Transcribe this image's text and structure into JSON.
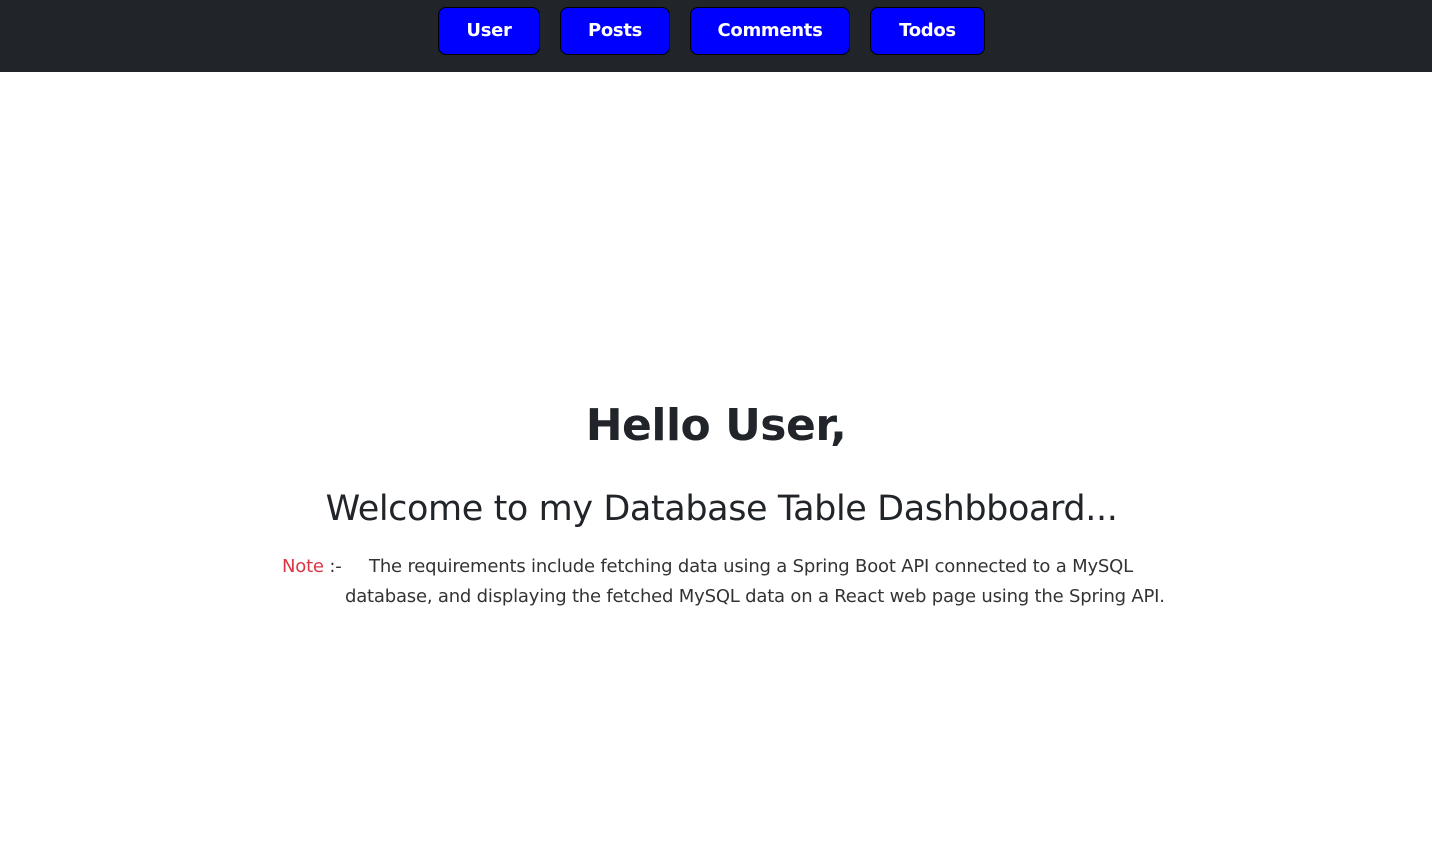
{
  "navbar": {
    "buttons": [
      {
        "label": "User"
      },
      {
        "label": "Posts"
      },
      {
        "label": "Comments"
      },
      {
        "label": "Todos"
      }
    ]
  },
  "main": {
    "title": "Hello User,",
    "subtitle": "Welcome to my Database Table Dashbboard...",
    "note": {
      "label": "Note",
      "separator": ":-",
      "line1": "The requirements include fetching data using a Spring Boot API connected to a MySQL",
      "line2": "database, and displaying the fetched MySQL data on a React web page using the Spring API."
    }
  },
  "colors": {
    "navbar_bg": "#212529",
    "button_bg": "#0000ff",
    "note_label": "#dc3545"
  }
}
